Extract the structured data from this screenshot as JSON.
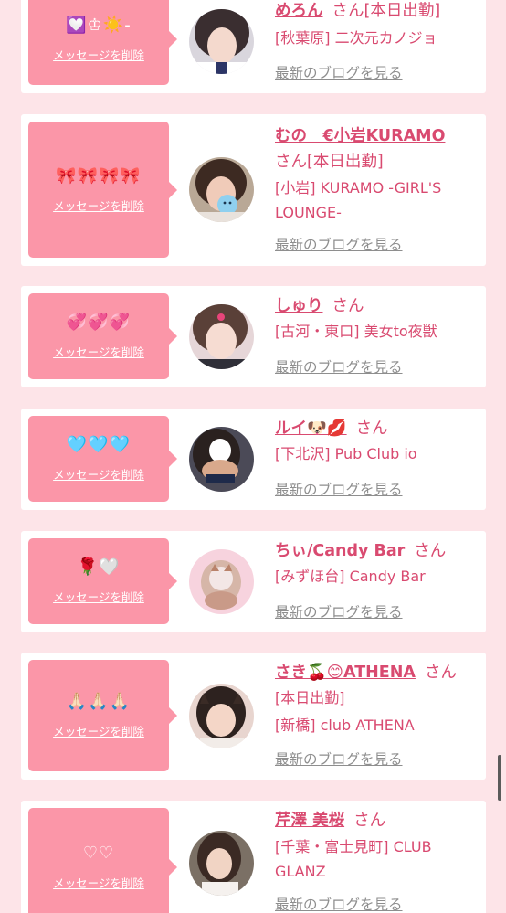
{
  "colors": {
    "page_background": "#fde4e8",
    "card_background": "#ffffff",
    "bubble_pink": "#fb96a8",
    "name_text": "#d94a70",
    "link_gray": "#8e8e8e"
  },
  "common": {
    "delete_label": "メッセージを削除",
    "blog_label": "最新のブログを見る",
    "san": "さん"
  },
  "messages": [
    {
      "emoji": "💟♔☀️-",
      "name": "めろん",
      "tag": "[本日出勤]",
      "shop": "[秋葉原] 二次元カノジョ"
    },
    {
      "emoji": "🎀🎀🎀🎀",
      "name": "むの　€小岩KURAMO",
      "tag": "[本日出勤]",
      "shop": "[小岩] KURAMO -GIRL'S LOUNGE-"
    },
    {
      "emoji": "💞💞💞",
      "name": "しゅり",
      "shop": "[古河・東口] 美女to夜獣"
    },
    {
      "emoji": "🩵🩵🩵",
      "name": "ルイ🐶💋",
      "shop": "[下北沢] Pub Club io"
    },
    {
      "emoji": "🌹🤍",
      "name": "ちぃ/Candy Bar",
      "shop": "[みずほ台] Candy Bar"
    },
    {
      "emoji": "🙏🏻🙏🏻🙏🏻",
      "name": "さき🍒😊ATHENA",
      "tag": "[本日出勤]",
      "shop": "[新橋] club ATHENA"
    },
    {
      "emoji": "♡♡",
      "name": "芹澤 美桜",
      "tag": "[千葉・富士見町] CLUB GLANZ"
    }
  ]
}
